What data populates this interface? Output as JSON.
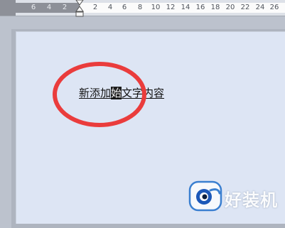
{
  "ruler": {
    "left_numbers": [
      "6",
      "4",
      "2"
    ],
    "right_numbers": [
      "2",
      "4",
      "6",
      "8",
      "10",
      "12",
      "14",
      "16",
      "18",
      "20",
      "22",
      "24",
      "26"
    ]
  },
  "document": {
    "before": "新添加",
    "selected": "始",
    "after": "文字内容"
  },
  "annotation": {
    "color": "#ea3c3c"
  },
  "watermark": {
    "text": "好装机"
  }
}
